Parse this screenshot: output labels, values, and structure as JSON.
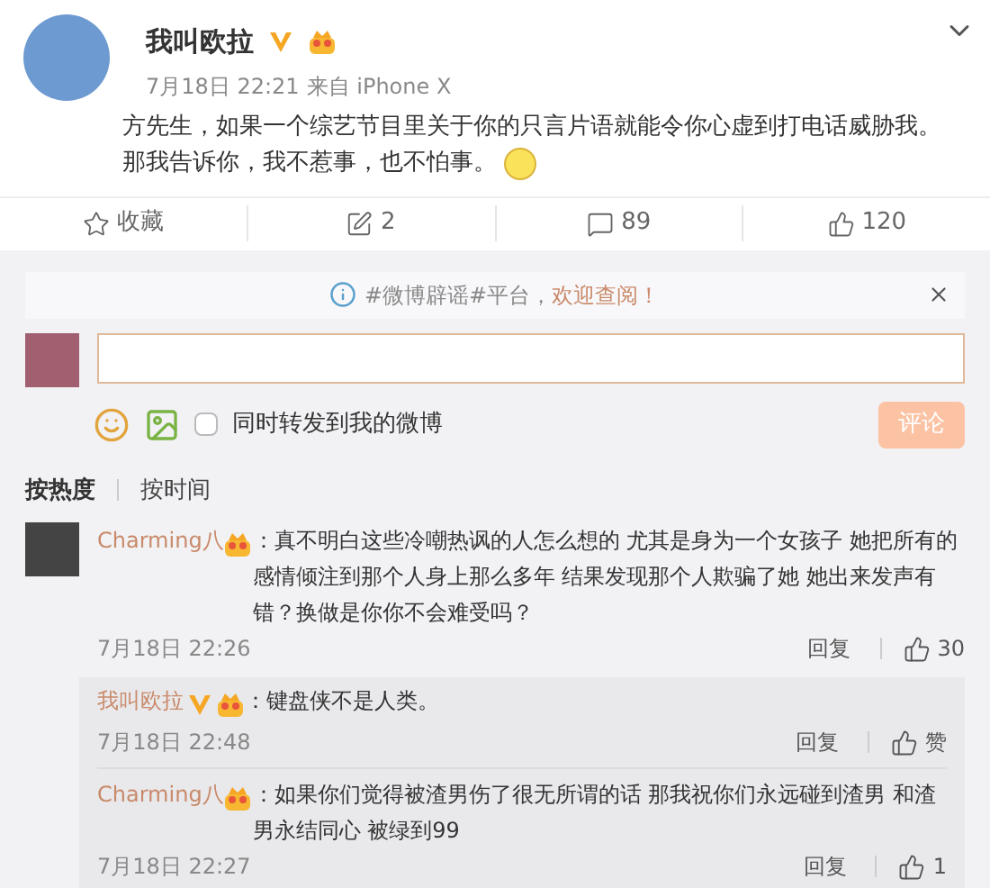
{
  "post": {
    "author": "我叫欧拉",
    "verified": true,
    "time": "7月18日 22:21",
    "source": "来自 iPhone X",
    "lines": [
      "方先生，如果一个综艺节目里关于你的只言片语就能令你心虚到打电话威胁我。",
      "那我告诉你，我不惹事，也不怕事。"
    ]
  },
  "actions": [
    {
      "kind": "favorite",
      "label": "收藏"
    },
    {
      "kind": "repost",
      "label": "2"
    },
    {
      "kind": "comment",
      "label": "89"
    },
    {
      "kind": "like",
      "label": "120"
    }
  ],
  "notice": {
    "text": "#微博辟谣#平台，",
    "link": "欢迎查阅！"
  },
  "composer": {
    "repost": {
      "label": "同时转发到我的微博",
      "checked": false
    },
    "submit": {
      "label": "评论",
      "disabled": true
    }
  },
  "sort_tabs": [
    {
      "label": "按热度",
      "selected": true
    },
    {
      "label": "按时间",
      "selected": false
    }
  ],
  "comments": [
    {
      "user": "Charming八",
      "text": "：真不明白这些冷嘲热讽的人怎么想的 尤其是身为一个女孩子 她把所有的感情倾注到那个人身上那么多年 结果发现那个人欺骗了她 她出来发声有错？换做是你你不会难受吗？",
      "time": "7月18日 22:26",
      "reply": "回复",
      "likes": "30",
      "replies": [
        {
          "user": "我叫欧拉",
          "verified": true,
          "text": "：键盘侠不是人类。",
          "time": "7月18日 22:48",
          "reply": "回复",
          "likes": "赞"
        },
        {
          "user": "Charming八",
          "verified": false,
          "text": "：如果你们觉得被渣男伤了很无所谓的话 那我祝你们永远碰到渣男 和渣男永结同心 被绿到99",
          "time": "7月18日 22:27",
          "reply": "回复",
          "likes": "1"
        }
      ]
    }
  ]
}
